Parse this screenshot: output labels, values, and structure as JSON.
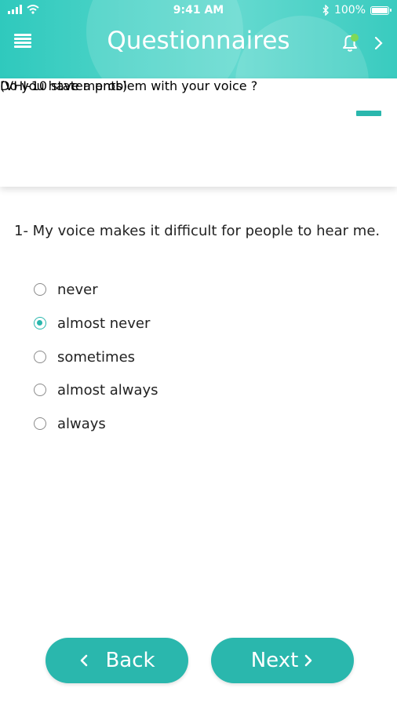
{
  "status_bar": {
    "time": "9:41 AM",
    "battery": "100%",
    "battery_level": 1.0
  },
  "header": {
    "title": "Questionnaires",
    "icons": [
      "menu-icon",
      "bell-icon",
      "chevron-right-icon"
    ],
    "notification_dot_color": "#7ed957"
  },
  "section": {
    "statements_label": "(VHI-10 statements)",
    "question": "Do you have a problem with your voice ?"
  },
  "item": {
    "text": "1- My voice makes it difficult for people to hear me.",
    "options": [
      {
        "label": "never",
        "selected": false
      },
      {
        "label": "almost never",
        "selected": true
      },
      {
        "label": "sometimes",
        "selected": false
      },
      {
        "label": "almost always",
        "selected": false
      },
      {
        "label": "always",
        "selected": false
      }
    ]
  },
  "buttons": {
    "back_label": "Back",
    "next_label": "Next"
  },
  "colors": {
    "accent": "#2ab7ad",
    "header_bg": "#4fd4c8",
    "text": "#222222"
  }
}
